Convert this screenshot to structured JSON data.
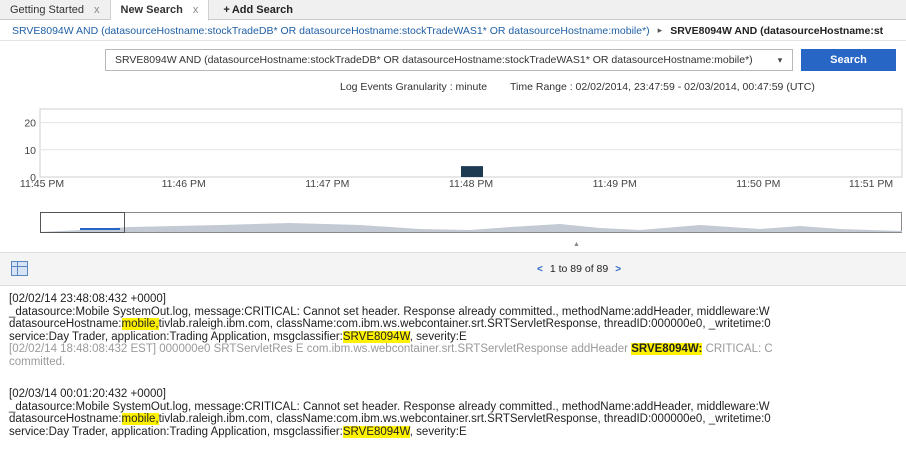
{
  "tabs": [
    {
      "label": "Getting Started",
      "close": "x"
    },
    {
      "label": "New Search",
      "close": "x"
    },
    {
      "label": "Add Search",
      "prefix": "+"
    }
  ],
  "breadcrumb": {
    "query_link": "SRVE8094W AND (datasourceHostname:stockTradeDB* OR datasourceHostname:stockTradeWAS1* OR datasourceHostname:mobile*)",
    "separator": "▸",
    "current": "SRVE8094W AND (datasourceHostname:st"
  },
  "query": {
    "text": "SRVE8094W AND (datasourceHostname:stockTradeDB* OR datasourceHostname:stockTradeWAS1* OR datasourceHostname:mobile*)",
    "dropdown": "▾"
  },
  "search_button": "Search",
  "meta": {
    "granularity": "Log Events Granularity : minute",
    "time_range": "Time Range : 02/02/2014, 23:47:59 - 02/03/2014, 00:47:59 (UTC)"
  },
  "chart_data": {
    "type": "bar",
    "y_ticks": [
      "20",
      "10",
      "0"
    ],
    "ylim": [
      0,
      25
    ],
    "grid": true,
    "x_ticks": [
      "11:45 PM",
      "11:46 PM",
      "11:47 PM",
      "11:48 PM",
      "11:49 PM",
      "11:50 PM",
      "11:51 PM"
    ],
    "bars": [
      {
        "x": "11:48 PM",
        "value": 4
      }
    ],
    "bar_color": "#1e3a52"
  },
  "overview": {
    "handle": "▲"
  },
  "results": {
    "prev": "<",
    "range": "1 to 89 of 89",
    "next": ">"
  },
  "events": [
    {
      "timestamp": "[02/02/14 23:48:08:432 +0000]",
      "line1": "_datasource:Mobile SystemOut.log, message:CRITICAL: Cannot set header. Response already committed., methodName:addHeader, middleware:W",
      "line2_pre": "datasourceHostname:",
      "line2_hl": "mobile,",
      "line2_post": "tivlab.raleigh.ibm.com, className:com.ibm.ws.webcontainer.srt.SRTServletResponse, threadID:000000e0, _writetime:0",
      "line3_pre": "service:Day Trader, application:Trading Application, msgclassifier:",
      "line3_hl": "SRVE8094W",
      "line3_post": ", severity:E",
      "raw_pre": "[02/02/14 18:48:08:432 EST] 000000e0 SRTServletRes E com.ibm.ws.webcontainer.srt.SRTServletResponse addHeader ",
      "raw_hl": "SRVE8094W:",
      "raw_post": " CRITICAL: C",
      "raw2": "committed."
    },
    {
      "timestamp": "[02/03/14 00:01:20:432 +0000]",
      "line1": "_datasource:Mobile SystemOut.log, message:CRITICAL: Cannot set header. Response already committed., methodName:addHeader, middleware:W",
      "line2_pre": "datasourceHostname:",
      "line2_hl": "mobile,",
      "line2_post": "tivlab.raleigh.ibm.com, className:com.ibm.ws.webcontainer.srt.SRTServletResponse, threadID:000000e0, _writetime:0",
      "line3_pre": "service:Day Trader, application:Trading Application, msgclassifier:",
      "line3_hl": "SRVE8094W",
      "line3_post": ", severity:E"
    }
  ]
}
